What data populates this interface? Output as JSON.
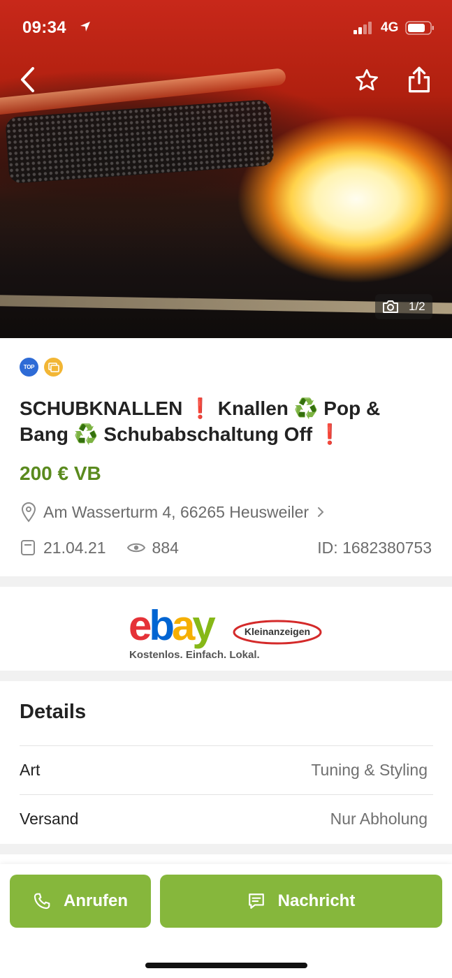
{
  "status_bar": {
    "time": "09:34",
    "network": "4G"
  },
  "nav": {
    "back_icon": "chevron-left-icon",
    "favorite_icon": "star-icon",
    "share_icon": "share-icon"
  },
  "gallery": {
    "counter": "1/2",
    "icon": "camera-icon"
  },
  "badges": {
    "top": "TOP",
    "gallery_icon": "gallery-icon"
  },
  "listing": {
    "title": "SCHUBKNALLEN ❗ Knallen ♻️ Pop & Bang ♻️ Schubabschaltung Off ❗",
    "price": "200 € VB",
    "location": "Am Wasserturm 4, 66265 Heusweiler",
    "date": "21.04.21",
    "views": "884",
    "id": "ID: 1682380753"
  },
  "ad_banner": {
    "logo_e": "e",
    "logo_b": "b",
    "logo_a": "a",
    "logo_y": "y",
    "badge": "Kleinanzeigen",
    "slogan": "Kostenlos. Einfach. Lokal."
  },
  "details": {
    "title": "Details",
    "rows": [
      {
        "key": "Art",
        "value": "Tuning & Styling"
      },
      {
        "key": "Versand",
        "value": "Nur Abholung"
      }
    ]
  },
  "actions": {
    "call_label": "Anrufen",
    "message_label": "Nachricht"
  },
  "colors": {
    "accent_green": "#86b73c",
    "price_green": "#5a8a1e",
    "top_badge": "#2e6bd6",
    "gallery_badge": "#f2b635"
  }
}
